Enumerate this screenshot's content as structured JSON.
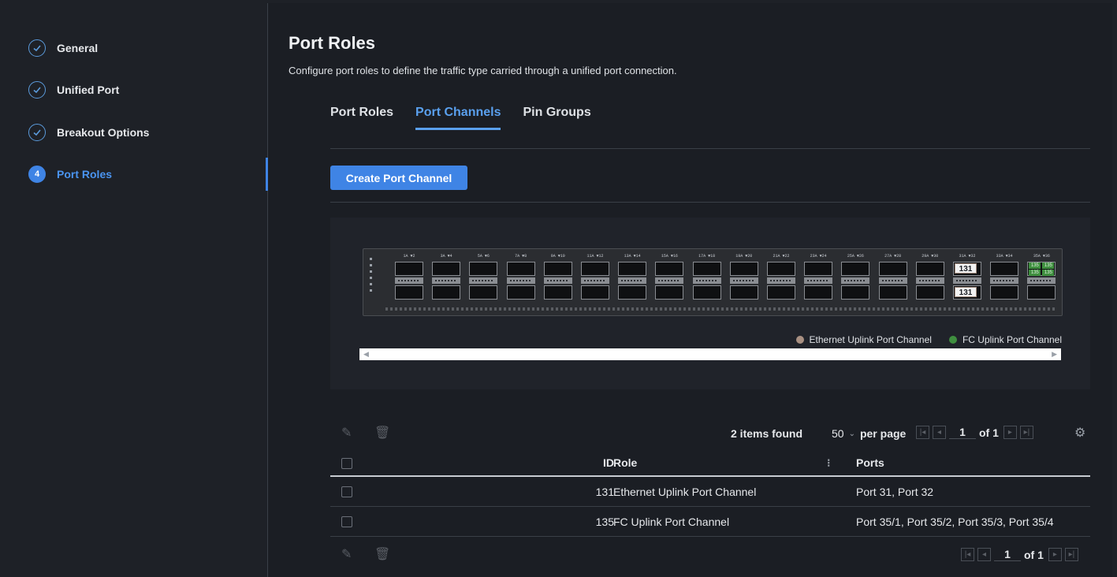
{
  "sidebar": {
    "steps": [
      {
        "label": "General",
        "state": "done"
      },
      {
        "label": "Unified Port",
        "state": "done"
      },
      {
        "label": "Breakout Options",
        "state": "done"
      },
      {
        "label": "Port Roles",
        "state": "active",
        "number": "4"
      }
    ]
  },
  "page": {
    "title": "Port Roles",
    "description": "Configure port roles to define the traffic type carried through a unified port connection."
  },
  "tabs": [
    {
      "label": "Port Roles",
      "active": false
    },
    {
      "label": "Port Channels",
      "active": true
    },
    {
      "label": "Pin Groups",
      "active": false
    }
  ],
  "actions": {
    "create_label": "Create Port Channel"
  },
  "switch": {
    "port_headers": [
      "1A ▼2",
      "3A ▼4",
      "5A ▼6",
      "7A ▼8",
      "9A ▼10",
      "11A ▼12",
      "13A ▼14",
      "15A ▼16",
      "17A ▼18",
      "19A ▼20",
      "21A ▼22",
      "23A ▼24",
      "25A ▼26",
      "27A ▼28",
      "29A ▼30",
      "31A ▼32",
      "33A ▼34",
      "35A ▼36"
    ],
    "eth_channel_label": "131",
    "fc_channel_labels": [
      "135",
      "135",
      "135",
      "135"
    ]
  },
  "legend": [
    {
      "label": "Ethernet Uplink Port Channel",
      "color": "#a89082"
    },
    {
      "label": "FC Uplink Port Channel",
      "color": "#3f8f3f"
    }
  ],
  "toolbar": {
    "items_found": "2 items found",
    "per_page_value": "50",
    "per_page_label": "per page",
    "page_current": "1",
    "page_of": "of 1"
  },
  "table": {
    "columns": {
      "id": "ID",
      "role": "Role",
      "ports": "Ports"
    },
    "rows": [
      {
        "id": "131",
        "role": "Ethernet Uplink Port Channel",
        "ports": "Port 31, Port 32"
      },
      {
        "id": "135",
        "role": "FC Uplink Port Channel",
        "ports": "Port 35/1, Port 35/2, Port 35/3, Port 35/4"
      }
    ]
  },
  "footer": {
    "page_current": "1",
    "page_of": "of 1"
  }
}
